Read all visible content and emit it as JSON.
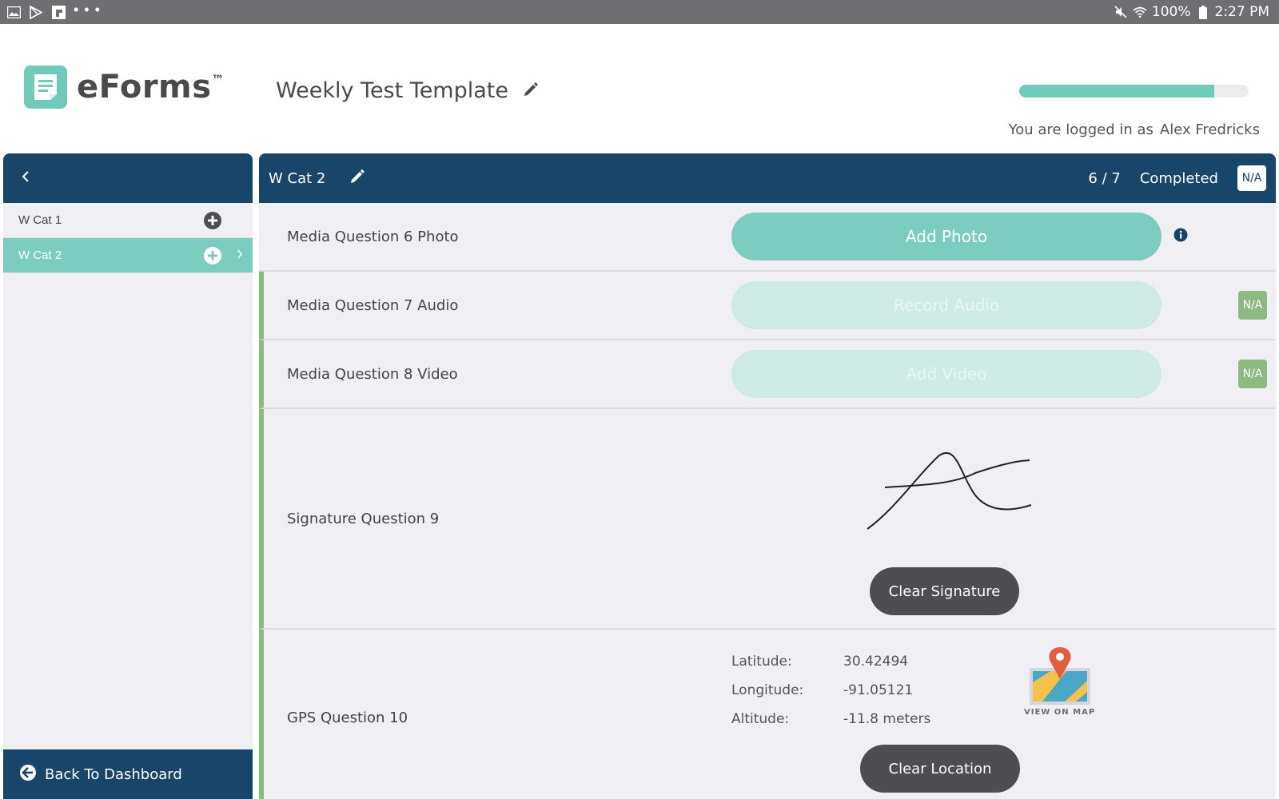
{
  "status_bar": {
    "battery": "100%",
    "time": "2:27 PM",
    "icons": [
      "gallery-icon",
      "play-store-icon",
      "flipboard-icon",
      "more-dots-icon",
      "mute-icon",
      "wifi-icon",
      "battery-icon"
    ]
  },
  "header": {
    "logo_text": "eForms",
    "logo_tm": "™",
    "form_title": "Weekly Test Template",
    "progress_fraction": 0.85,
    "logged_in_prefix": "You are logged in as",
    "user_name": "Alex Fredricks"
  },
  "sidebar": {
    "items": [
      {
        "label": "W Cat 1",
        "active": false
      },
      {
        "label": "W Cat 2",
        "active": true
      }
    ],
    "footer_label": "Back To Dashboard"
  },
  "main": {
    "category_title": "W Cat 2",
    "progress_count": "6 / 7",
    "completed_label": "Completed",
    "na_label": "N/A",
    "questions": [
      {
        "label": "Media Question 6 Photo",
        "button": "Add Photo"
      },
      {
        "label": "Media Question 7 Audio",
        "button": "Record Audio",
        "na": "N/A"
      },
      {
        "label": "Media Question 8 Video",
        "button": "Add Video",
        "na": "N/A"
      },
      {
        "label": "Signature Question 9",
        "button": "Clear Signature"
      },
      {
        "label": "GPS Question 10",
        "button": "Clear Location",
        "latitude_label": "Latitude:",
        "latitude": "30.42494",
        "longitude_label": "Longitude:",
        "longitude": "-91.05121",
        "altitude_label": "Altitude:",
        "altitude": "-11.8 meters",
        "view_map_label": "VIEW ON MAP"
      }
    ]
  },
  "colors": {
    "navy": "#17466a",
    "teal": "#7ccdbf",
    "green": "#8dba7e",
    "dark_button": "#4d4d52"
  }
}
